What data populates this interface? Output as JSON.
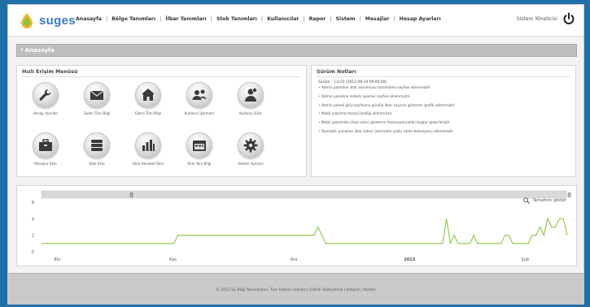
{
  "brand": {
    "name": "suges",
    "accent": "#3b7cc2",
    "chart_color": "#8cc540"
  },
  "nav": {
    "items": [
      "Anasayfa",
      "Bölge Tanımları",
      "İlbar Tanımları",
      "Stok Tanımları",
      "Kullanıcılar",
      "Rapor",
      "Sistem",
      "Mesajlar",
      "Hesap Ayarları"
    ]
  },
  "user": {
    "label": "Sistem Yöneticisi",
    "icon": "power-icon"
  },
  "breadcrumb": {
    "label": "Anasayfa"
  },
  "quick_access": {
    "title": "Hızlı Erişim Menüsü",
    "tiles": [
      {
        "label": "Hesap Ayarları",
        "icon": "wrench-icon"
      },
      {
        "label": "Gelen Tüm Bilgi",
        "icon": "mail-icon"
      },
      {
        "label": "Ekleri Tüm Bilgi",
        "icon": "home-icon"
      },
      {
        "label": "Kullanıcı İşlemleri",
        "icon": "users-icon"
      },
      {
        "label": "Kullanıcı Ekle",
        "icon": "user-add-icon"
      },
      {
        "label": "Mesajlar Ekle",
        "icon": "briefcase-icon"
      },
      {
        "label": "Stok Ekle",
        "icon": "database-icon"
      },
      {
        "label": "Stok Hareketi Ekle",
        "icon": "bar-chart-icon"
      },
      {
        "label": "Ekle Yeni Bilgi",
        "icon": "calendar-icon"
      },
      {
        "label": "Sistem Ayarları",
        "icon": "gear-icon"
      }
    ]
  },
  "release_notes": {
    "title": "Sürüm Notları",
    "version": "Sürüm : 1.0.01 (2012-08-14 09:00:00)",
    "items": [
      "Admin paneline stok sorumlusu tanımlama sayfası eklenmiştir",
      "Admin paneline sistem ayarları sayfası eklenmiştir",
      "Admin paneli giriş sayfasına günlük ilbar sayısını gösteren grafik eklenmiştir",
      "Mobil yazılıma mesaj özelliği eklenmiştir",
      "Mobil yazılımda cihaz verisi gösterim fonksiyonundaki buglar giderilmiştir",
      "Operatör paneline ilbar listesi üzerinden çoklu silme fonksiyonu eklenmiştir"
    ]
  },
  "chart": {
    "zoom_label": "Tamamını göster",
    "range_start_label": "8",
    "range_end_label": "8",
    "footer": "© 2012 Su Bilgi Teknolojileri. Tüm hakları saklıdır | Gizlilik Sözleşmesi | İletişim | Yardım"
  },
  "chart_data": {
    "type": "line",
    "x_labels": [
      "Eki",
      "Kas",
      "Ara",
      "2013",
      "Şub"
    ],
    "y_ticks": [
      0,
      2,
      4,
      6
    ],
    "ylim": [
      0,
      6
    ],
    "series": [
      {
        "values": [
          1,
          1,
          1,
          1,
          1,
          1,
          1,
          1,
          1,
          1,
          1,
          1,
          1,
          1,
          1,
          1,
          1,
          1,
          1,
          1,
          1,
          1,
          1,
          1,
          1,
          1,
          1,
          1,
          1,
          1,
          1,
          1,
          1,
          1,
          1,
          2,
          2,
          2,
          2,
          2,
          2,
          2,
          2,
          2,
          2,
          2,
          2,
          2,
          2,
          2,
          2,
          2,
          2,
          2,
          2,
          2,
          2,
          2,
          2,
          2,
          2,
          2,
          2,
          2,
          2,
          2,
          2,
          2,
          2,
          2,
          2,
          3,
          2,
          1,
          1,
          1,
          1,
          1,
          1,
          1,
          1,
          1,
          1,
          1,
          1,
          1,
          1,
          1,
          1,
          1,
          1,
          1,
          1,
          1,
          1,
          1,
          1,
          1,
          1,
          1,
          1,
          1,
          1,
          1,
          4,
          1,
          2,
          1,
          1,
          1,
          1,
          2,
          1,
          1,
          1,
          1,
          1,
          1,
          1,
          2,
          2,
          1,
          1,
          1,
          1,
          1,
          2,
          2,
          3,
          2,
          4,
          3,
          3,
          4,
          4,
          2
        ]
      }
    ]
  }
}
